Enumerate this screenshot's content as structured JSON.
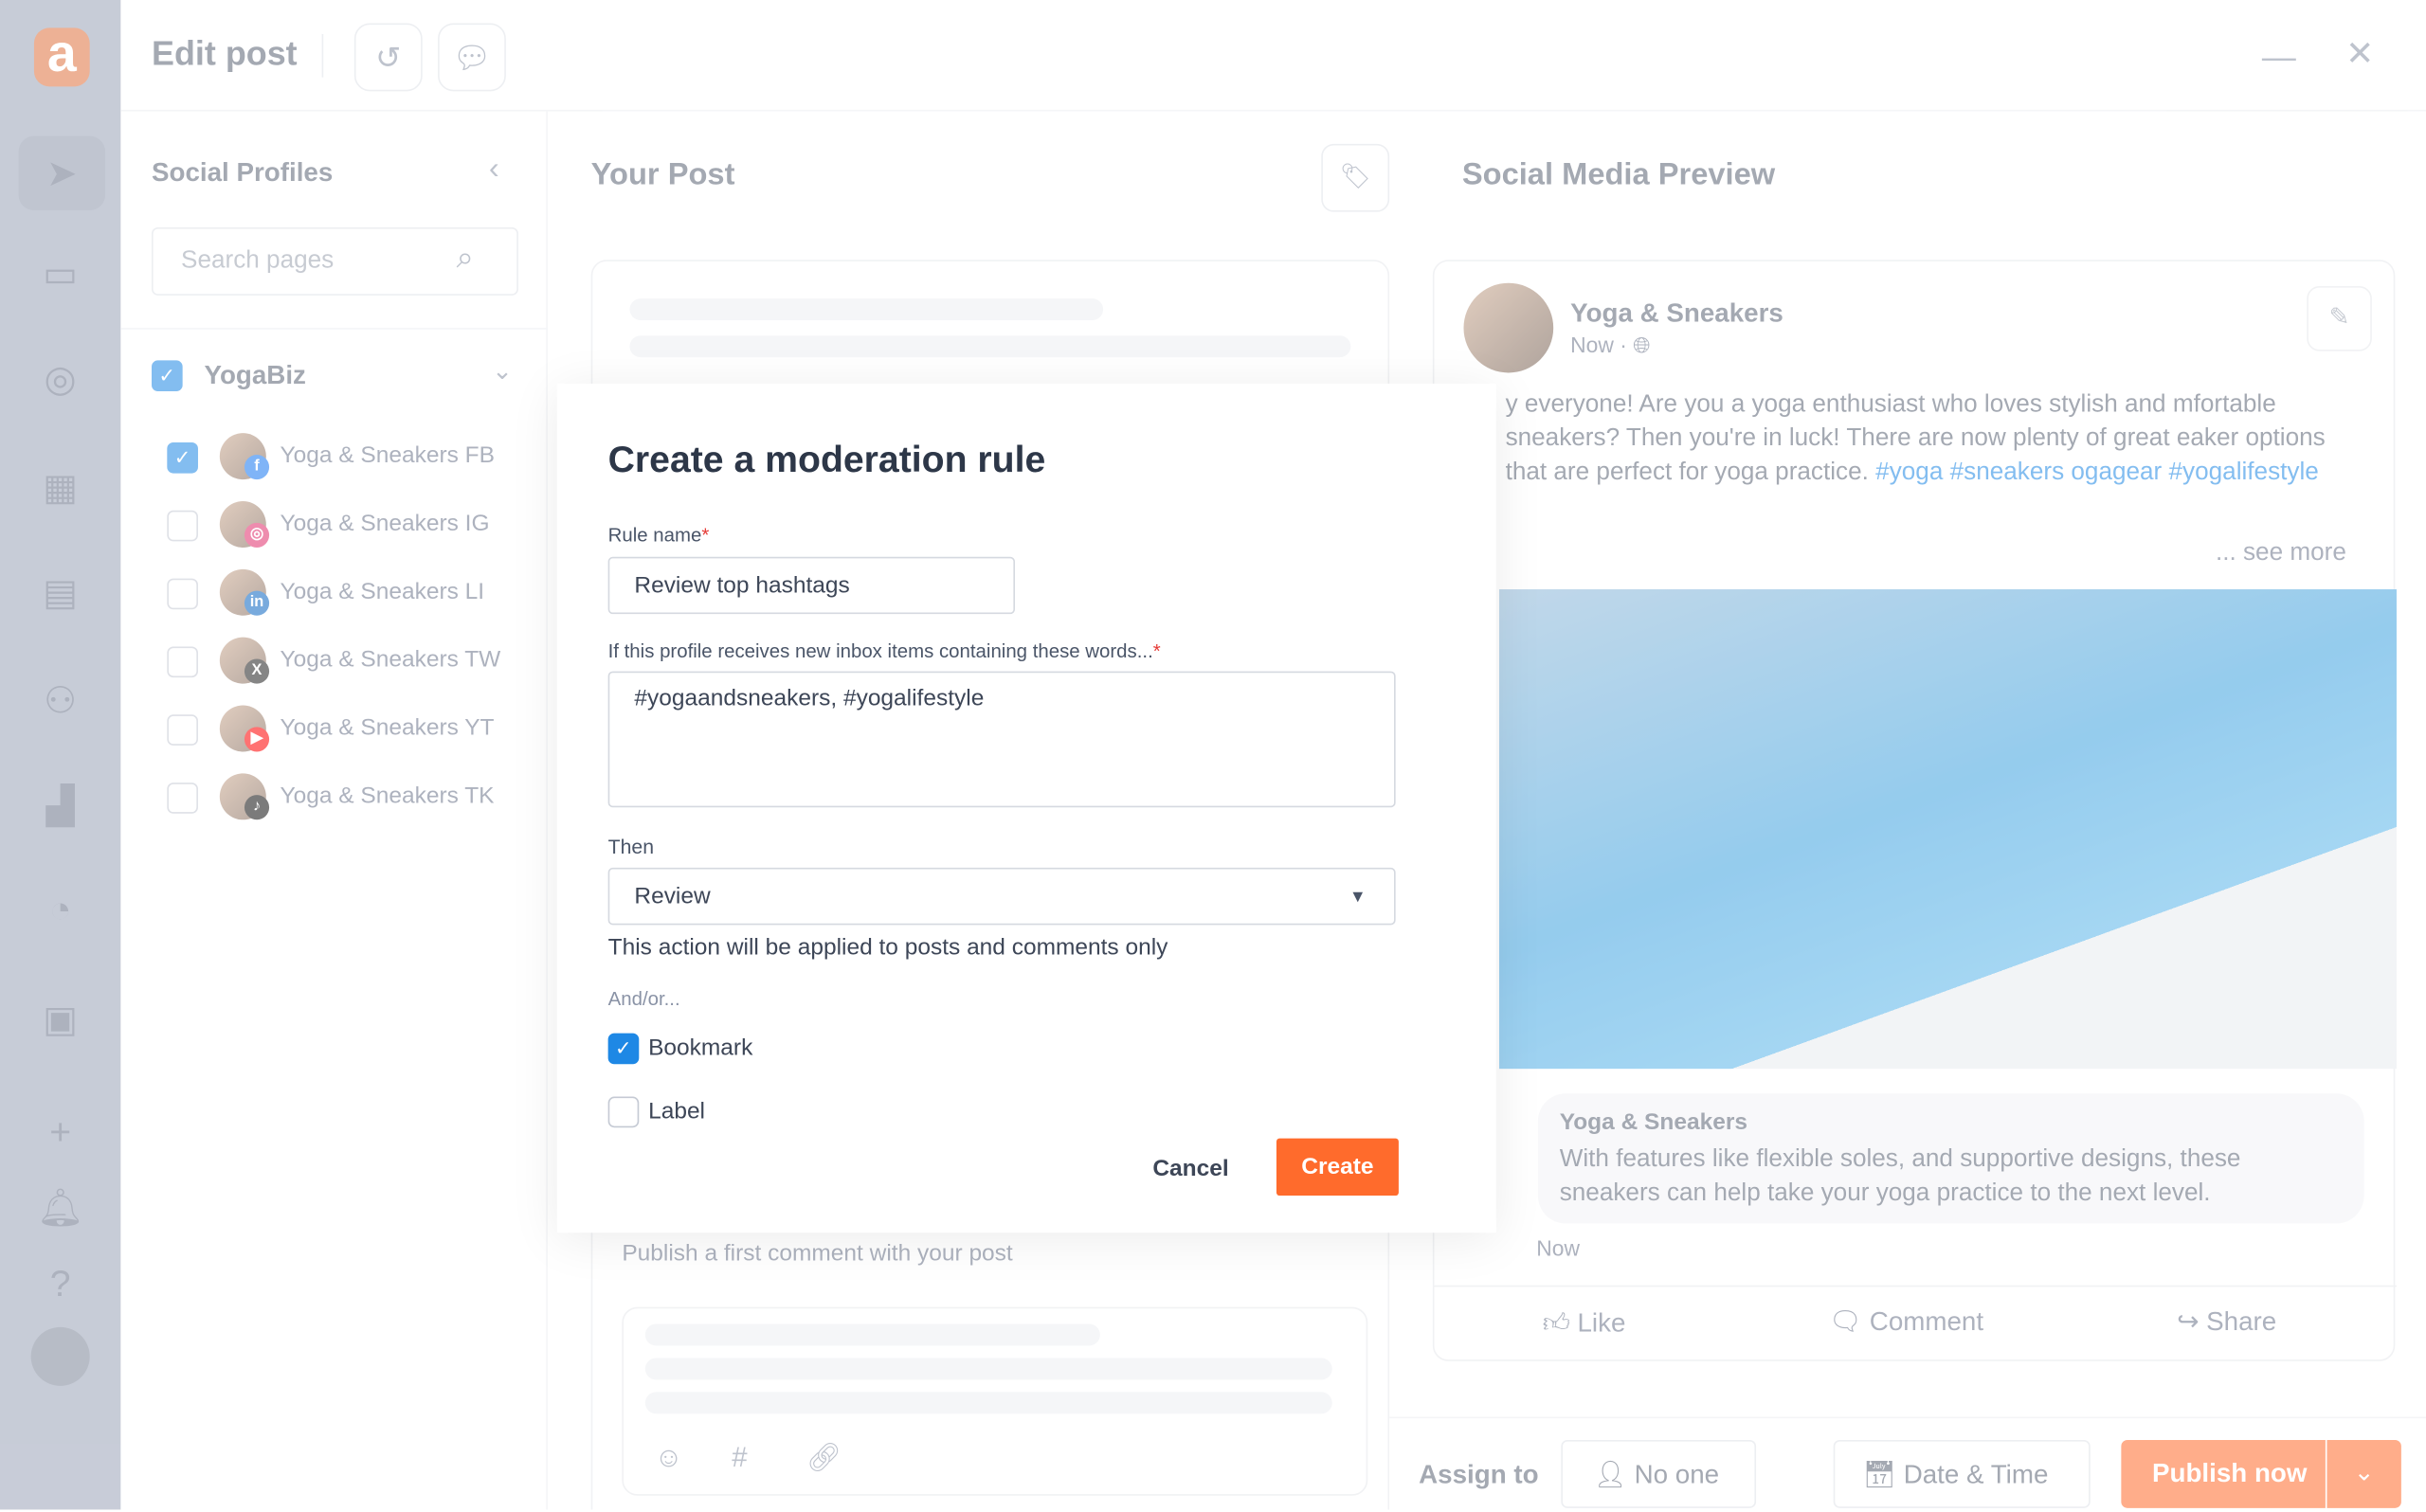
{
  "header": {
    "title": "Edit post",
    "history_icon": "history-icon",
    "chat_icon": "chat-icon"
  },
  "profiles": {
    "title": "Social Profiles",
    "search_placeholder": "Search pages",
    "group": "YogaBiz",
    "group_checked": true,
    "items": [
      {
        "name": "Yoga & Sneakers FB",
        "checked": true,
        "network": "facebook",
        "color": "#1877f2"
      },
      {
        "name": "Yoga & Sneakers IG",
        "checked": false,
        "network": "instagram",
        "color": "#e1306c"
      },
      {
        "name": "Yoga & Sneakers LI",
        "checked": false,
        "network": "linkedin",
        "color": "#0a66c2"
      },
      {
        "name": "Yoga & Sneakers TW",
        "checked": false,
        "network": "x",
        "color": "#222222"
      },
      {
        "name": "Yoga & Sneakers YT",
        "checked": false,
        "network": "youtube",
        "color": "#ff0000"
      },
      {
        "name": "Yoga & Sneakers TK",
        "checked": false,
        "network": "tiktok",
        "color": "#111111"
      }
    ]
  },
  "post": {
    "title": "Your Post",
    "first_comment_placeholder": "Publish a first comment with your post"
  },
  "preview": {
    "title": "Social Media Preview",
    "page_name": "Yoga & Sneakers",
    "time": "Now ·",
    "text": "y everyone! Are you a yoga enthusiast who loves stylish and mfortable sneakers? Then you're in luck! There are now plenty of great eaker options that are perfect for yoga practice.",
    "hashtags": "#yoga #sneakers ogagear #yogalifestyle",
    "see_more": "... see more",
    "comment_author": "Yoga & Sneakers",
    "comment_text": "With features like flexible soles, and supportive designs, these sneakers can help take your yoga practice to the next level.",
    "comment_time": "Now",
    "actions": {
      "like": "Like",
      "comment": "Comment",
      "share": "Share"
    }
  },
  "footer": {
    "assign_label": "Assign to",
    "assignee": "No one",
    "date_time": "Date & Time",
    "publish": "Publish now",
    "accent": "#ff6b2c"
  },
  "modal": {
    "title": "Create a moderation rule",
    "rule_name_label": "Rule name",
    "rule_name_value": "Review top hashtags",
    "words_label": "If this profile receives new inbox items containing these words...",
    "words_value": "#yogaandsneakers, #yogalifestyle",
    "then_label": "Then",
    "then_value": "Review",
    "then_hint": "This action will be applied to posts and comments only",
    "andor_label": "And/or...",
    "bookmark_label": "Bookmark",
    "bookmark_checked": true,
    "label_label": "Label",
    "label_checked": false,
    "cancel": "Cancel",
    "create": "Create",
    "required_mark": "*"
  }
}
